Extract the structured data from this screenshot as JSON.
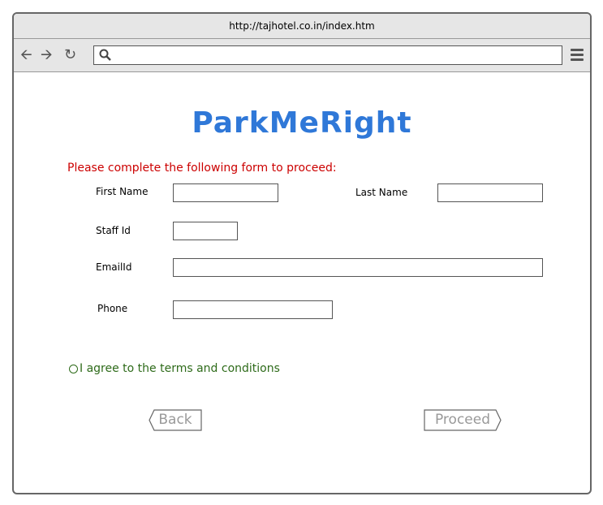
{
  "browser": {
    "url": "http://tajhotel.co.in/index.htm",
    "search_placeholder": ""
  },
  "app": {
    "title": "ParkMeRight",
    "instruction": "Please complete the following form to proceed:"
  },
  "form": {
    "first_name_label": "First Name",
    "last_name_label": "Last Name",
    "staff_id_label": "Staff Id",
    "email_label": "EmailId",
    "phone_label": "Phone",
    "first_name_value": "",
    "last_name_value": "",
    "staff_id_value": "",
    "email_value": "",
    "phone_value": "",
    "agree_label": "I agree to the terms and conditions"
  },
  "actions": {
    "back_label": "Back",
    "proceed_label": "Proceed"
  },
  "colors": {
    "brand": "#2f78d8",
    "instruction": "#cc0000",
    "agree": "#2e6b1a",
    "button_text": "#999999"
  },
  "icons": [
    "back-arrow-icon",
    "forward-arrow-icon",
    "reload-icon",
    "search-icon",
    "hamburger-menu-icon",
    "radio-icon"
  ]
}
